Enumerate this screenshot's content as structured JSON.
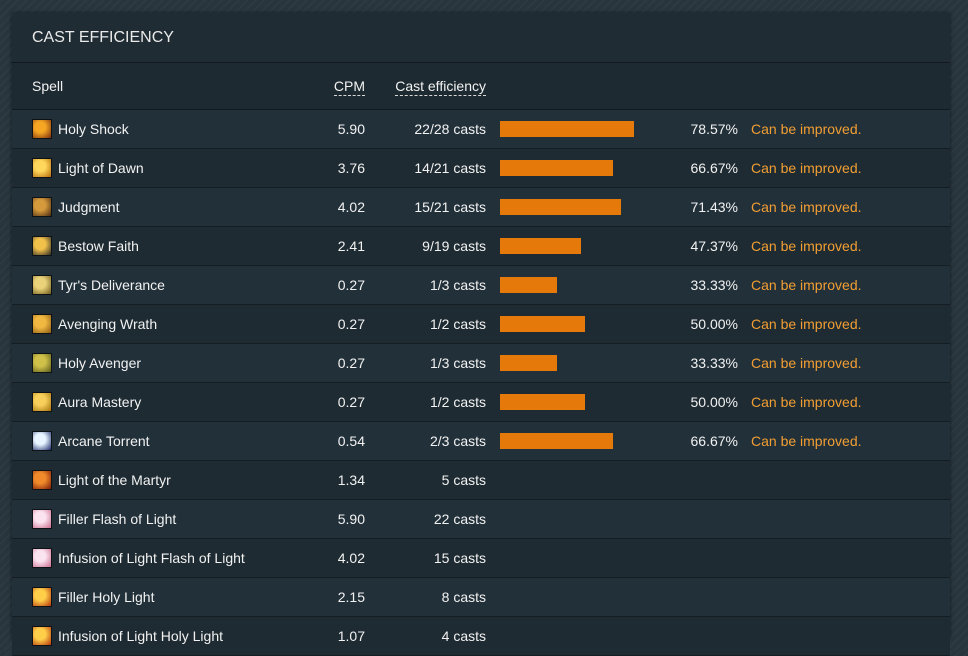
{
  "panel": {
    "title": "CAST EFFICIENCY"
  },
  "columns": {
    "spell": "Spell",
    "cpm": "CPM",
    "cast_efficiency": "Cast efficiency"
  },
  "colors": {
    "bar": "#e5790a",
    "note": "#f29e33"
  },
  "rows": [
    {
      "icon": "holy-shock-icon",
      "icon_colors": [
        "#f5a623",
        "#7a2d0c"
      ],
      "spell": "Holy Shock",
      "cpm": "5.90",
      "casts": "22/28 casts",
      "efficiency": 0.7857,
      "pct": "78.57%",
      "note": "Can be improved."
    },
    {
      "icon": "light-of-dawn-icon",
      "icon_colors": [
        "#ffd75a",
        "#b36a0b"
      ],
      "spell": "Light of Dawn",
      "cpm": "3.76",
      "casts": "14/21 casts",
      "efficiency": 0.6667,
      "pct": "66.67%",
      "note": "Can be improved."
    },
    {
      "icon": "judgment-icon",
      "icon_colors": [
        "#d59a3c",
        "#4a2a10"
      ],
      "spell": "Judgment",
      "cpm": "4.02",
      "casts": "15/21 casts",
      "efficiency": 0.7143,
      "pct": "71.43%",
      "note": "Can be improved."
    },
    {
      "icon": "bestow-faith-icon",
      "icon_colors": [
        "#f2c14a",
        "#2d2a24"
      ],
      "spell": "Bestow Faith",
      "cpm": "2.41",
      "casts": "9/19 casts",
      "efficiency": 0.4737,
      "pct": "47.37%",
      "note": "Can be improved."
    },
    {
      "icon": "tyrs-deliverance-icon",
      "icon_colors": [
        "#e9d27a",
        "#6e5a1c"
      ],
      "spell": "Tyr's Deliverance",
      "cpm": "0.27",
      "casts": "1/3 casts",
      "efficiency": 0.3333,
      "pct": "33.33%",
      "note": "Can be improved."
    },
    {
      "icon": "avenging-wrath-icon",
      "icon_colors": [
        "#f0b841",
        "#8c5a12"
      ],
      "spell": "Avenging Wrath",
      "cpm": "0.27",
      "casts": "1/2 casts",
      "efficiency": 0.5,
      "pct": "50.00%",
      "note": "Can be improved."
    },
    {
      "icon": "holy-avenger-icon",
      "icon_colors": [
        "#cfc04a",
        "#5a5a1a"
      ],
      "spell": "Holy Avenger",
      "cpm": "0.27",
      "casts": "1/3 casts",
      "efficiency": 0.3333,
      "pct": "33.33%",
      "note": "Can be improved."
    },
    {
      "icon": "aura-mastery-icon",
      "icon_colors": [
        "#f7cf5a",
        "#a5710d"
      ],
      "spell": "Aura Mastery",
      "cpm": "0.27",
      "casts": "1/2 casts",
      "efficiency": 0.5,
      "pct": "50.00%",
      "note": "Can be improved."
    },
    {
      "icon": "arcane-torrent-icon",
      "icon_colors": [
        "#e8f4ff",
        "#1a2a6a"
      ],
      "spell": "Arcane Torrent",
      "cpm": "0.54",
      "casts": "2/3 casts",
      "efficiency": 0.6667,
      "pct": "66.67%",
      "note": "Can be improved."
    },
    {
      "icon": "light-of-the-martyr-icon",
      "icon_colors": [
        "#f08a2a",
        "#7a1a08"
      ],
      "spell": "Light of the Martyr",
      "cpm": "1.34",
      "casts": "5 casts",
      "efficiency": null,
      "pct": "",
      "note": ""
    },
    {
      "icon": "flash-of-light-icon",
      "icon_colors": [
        "#fbe3ef",
        "#c96a8a"
      ],
      "spell": "Filler Flash of Light",
      "cpm": "5.90",
      "casts": "22 casts",
      "efficiency": null,
      "pct": "",
      "note": ""
    },
    {
      "icon": "flash-of-light-icon",
      "icon_colors": [
        "#fbe3ef",
        "#c96a8a"
      ],
      "spell": "Infusion of Light Flash of Light",
      "cpm": "4.02",
      "casts": "15 casts",
      "efficiency": null,
      "pct": "",
      "note": ""
    },
    {
      "icon": "holy-light-icon",
      "icon_colors": [
        "#ffcf4a",
        "#b3350a"
      ],
      "spell": "Filler Holy Light",
      "cpm": "2.15",
      "casts": "8 casts",
      "efficiency": null,
      "pct": "",
      "note": ""
    },
    {
      "icon": "holy-light-icon",
      "icon_colors": [
        "#ffcf4a",
        "#b3350a"
      ],
      "spell": "Infusion of Light Holy Light",
      "cpm": "1.07",
      "casts": "4 casts",
      "efficiency": null,
      "pct": "",
      "note": ""
    }
  ]
}
